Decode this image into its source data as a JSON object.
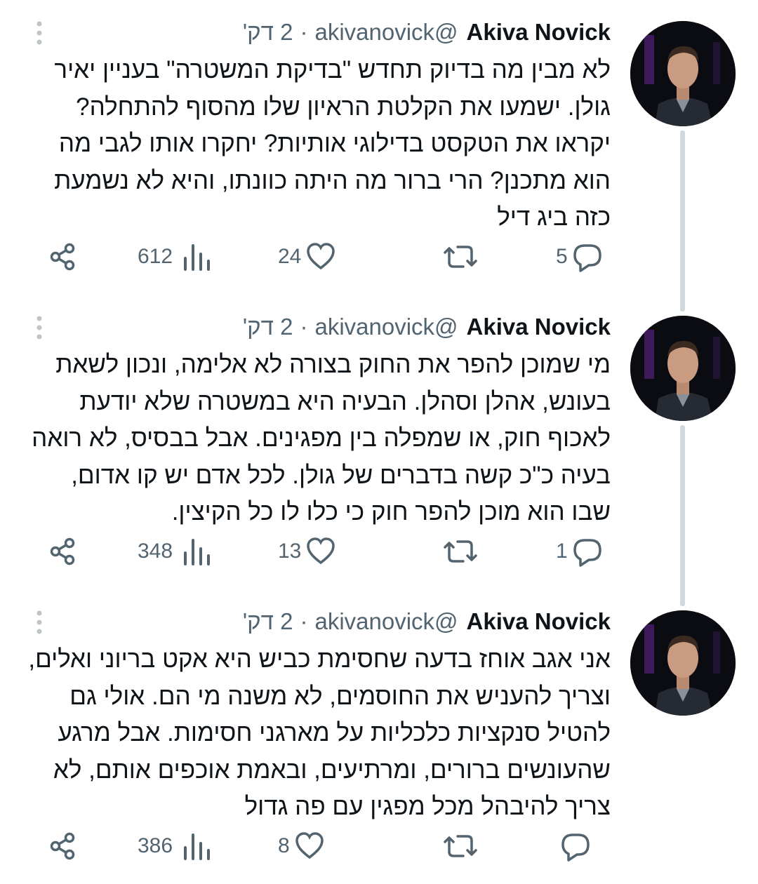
{
  "tweets": [
    {
      "author": {
        "name": "Akiva Novick",
        "handle": "@akivanovick"
      },
      "time": "2 דק'",
      "separator": "·",
      "text": "לא מבין מה בדיוק תחדש \"בדיקת המשטרה\" בעניין יאיר גולן. ישמעו את הקלטת הראיון שלו מהסוף להתחלה? יקראו את הטקסט בדילוגי אותיות? יחקרו אותו לגבי מה הוא מתכנן? הרי ברור מה היתה כוונתו, והיא לא נשמעת כזה ביג דיל",
      "stats": {
        "replies": "5",
        "retweets": "",
        "likes": "24",
        "views": "612"
      }
    },
    {
      "author": {
        "name": "Akiva Novick",
        "handle": "@akivanovick"
      },
      "time": "2 דק'",
      "separator": "·",
      "text": "מי שמוכן להפר את החוק בצורה לא אלימה, ונכון לשאת בעונש, אהלן וסהלן. הבעיה היא במשטרה שלא יודעת לאכוף חוק, או שמפלה בין מפגינים. אבל בבסיס, לא רואה בעיה כ\"כ קשה בדברים של גולן. לכל אדם יש קו אדום, שבו הוא מוכן להפר חוק כי כלו לו כל הקיצין.",
      "stats": {
        "replies": "1",
        "retweets": "",
        "likes": "13",
        "views": "348"
      }
    },
    {
      "author": {
        "name": "Akiva Novick",
        "handle": "@akivanovick"
      },
      "time": "2 דק'",
      "separator": "·",
      "text": "אני אגב אוחז בדעה שחסימת כביש היא אקט בריוני ואלים, וצריך להעניש את החוסמים, לא משנה מי הם. אולי גם להטיל סנקציות כלכליות על מארגני חסימות. אבל מרגע שהעונשים ברורים, ומרתיעים, ובאמת אוכפים אותם, לא צריך להיבהל מכל מפגין עם פה גדול",
      "stats": {
        "replies": "",
        "retweets": "",
        "likes": "8",
        "views": "386"
      }
    }
  ],
  "icons": {
    "more": "more-vertical-icon",
    "reply": "reply-icon",
    "retweet": "retweet-icon",
    "like": "heart-icon",
    "views": "views-icon",
    "share": "share-icon"
  },
  "colors": {
    "text": "#0f1419",
    "secondary": "#536471",
    "thread_line": "#cfd9de",
    "icon_gray": "#bfc4c8"
  }
}
